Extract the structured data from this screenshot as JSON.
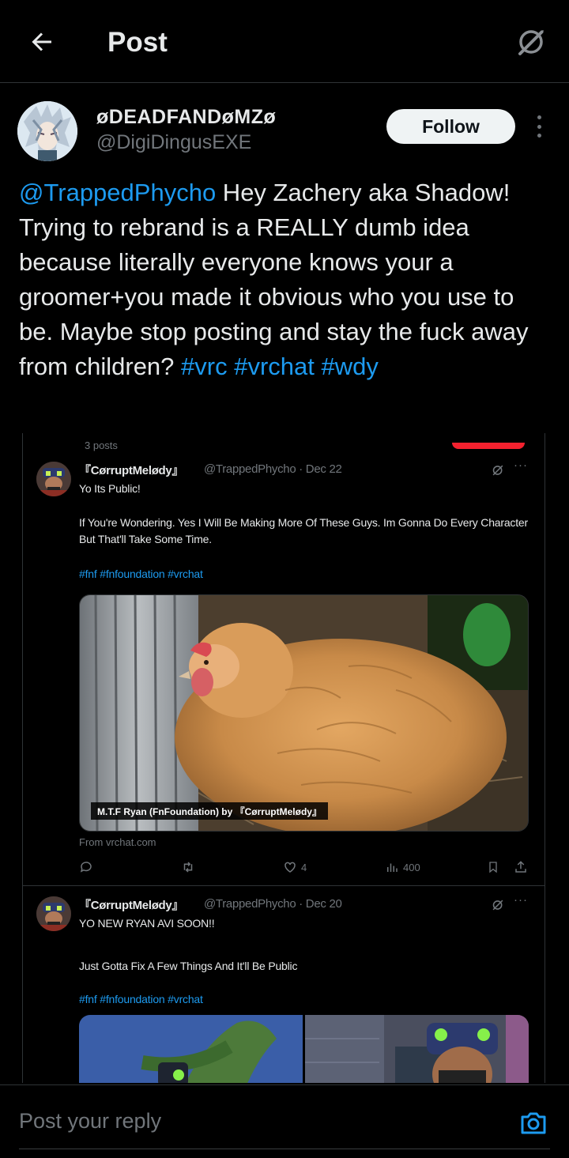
{
  "header": {
    "title": "Post",
    "back_icon": "arrow-left-icon",
    "grok_icon": "grok-icon"
  },
  "author": {
    "display_name": "øDEADFANDøMZø",
    "handle": "@DigiDingusEXE",
    "follow_label": "Follow",
    "more_icon": "more-vertical-icon"
  },
  "tweet": {
    "mention": "@TrappedPhycho",
    "body": " Hey Zachery aka Shadow! Trying to rebrand is a REALLY dumb idea because literally everyone knows your a groomer+you made it obvious who you use to be. Maybe stop posting and stay the fuck away from children? ",
    "hashtags": "#vrc #vrchat #wdy"
  },
  "screenshot": {
    "top_remnant": "3 posts",
    "tweet1": {
      "name": "『CørruptMelødy』",
      "meta": "@TrappedPhycho · Dec 22",
      "line1": "Yo Its Public!",
      "line2": "If You're Wondering. Yes I Will Be Making More Of These Guys. Im Gonna Do Every Character But That'll Take Some Time.",
      "tags": "#fnf #fnfoundation #vrchat",
      "caption": "M.T.F Ryan   (FnFoundation)   by  『CørruptMelødy』",
      "from": "From vrchat.com",
      "likes": "4",
      "views": "400"
    },
    "tweet2": {
      "name": "『CørruptMelødy』",
      "meta": "@TrappedPhycho · Dec 20",
      "line1": "YO NEW RYAN AVI SOON!!",
      "line2": "Just Gotta Fix A Few Things And It'll Be Public",
      "tags": "#fnf #fnfoundation #vrchat"
    }
  },
  "reply": {
    "placeholder": "Post your reply",
    "camera_icon": "camera-icon"
  },
  "colors": {
    "background": "#000000",
    "link": "#1d9bf0",
    "muted": "#71767b",
    "text": "#e7e9ea"
  }
}
